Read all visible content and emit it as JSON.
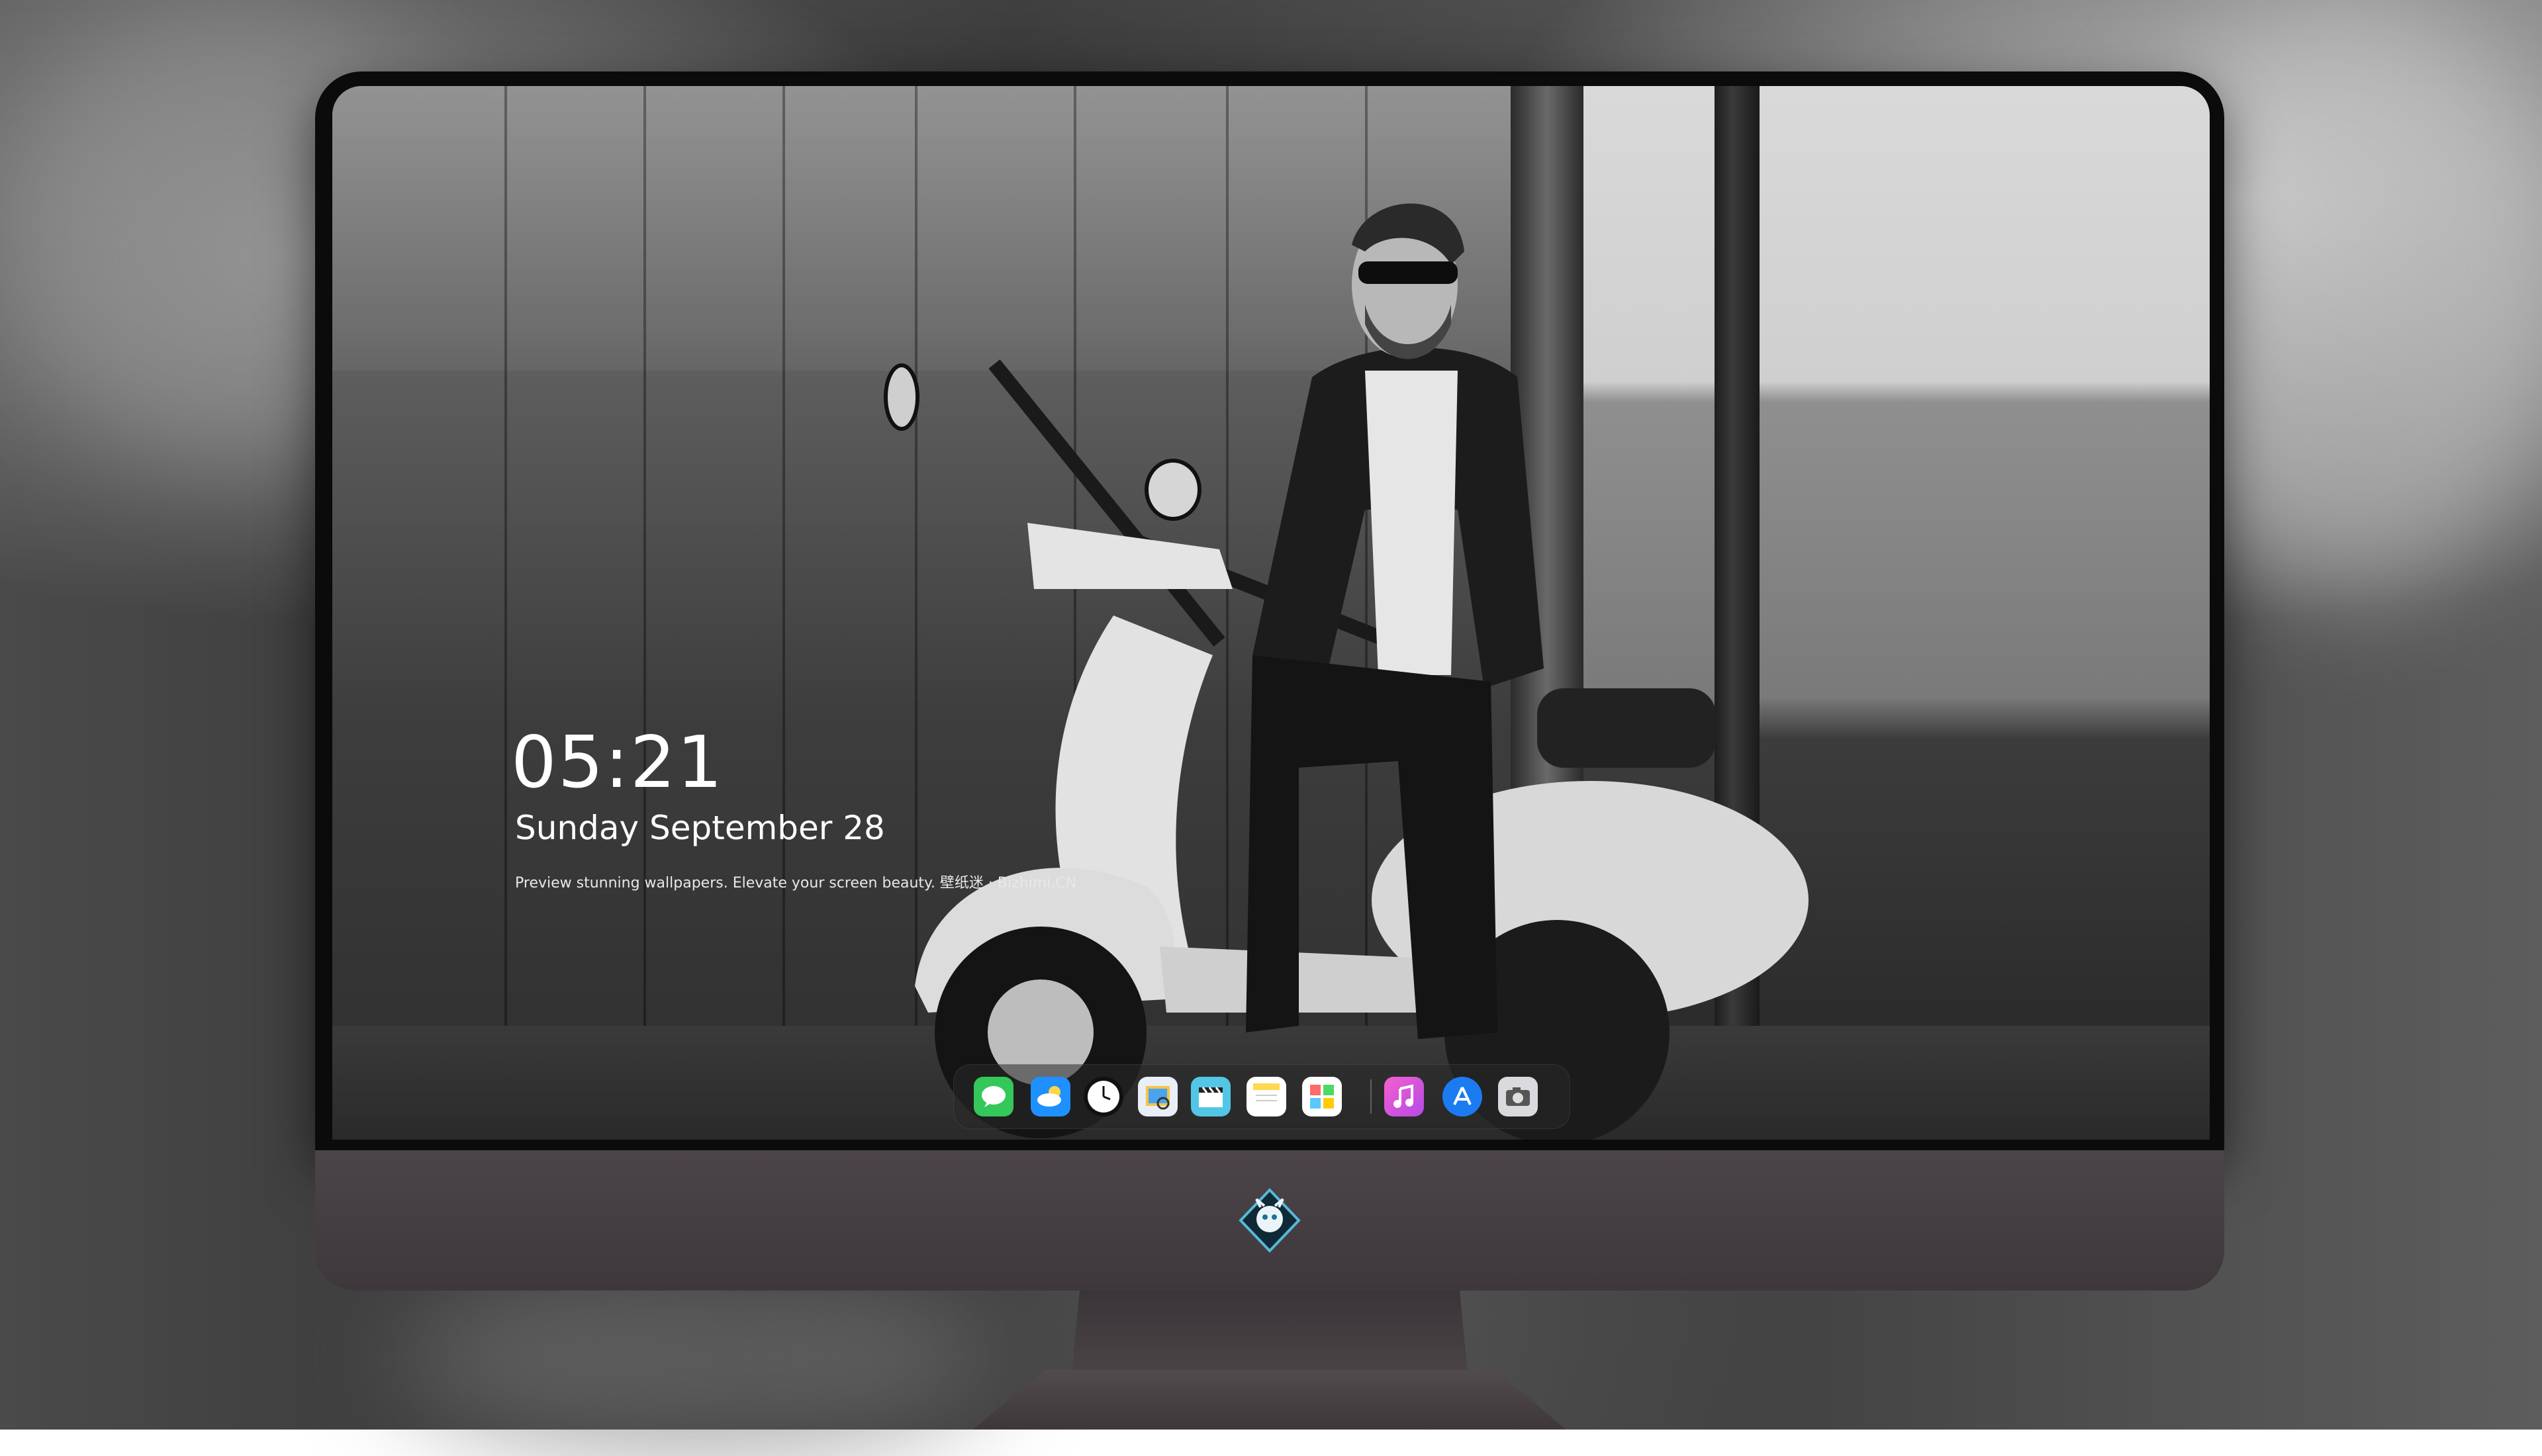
{
  "lock_screen": {
    "time": "05:21",
    "date": "Sunday September  28",
    "tagline": "Preview stunning wallpapers. Elevate your screen beauty. 壁纸迷 · Bizhimi.CN"
  },
  "dock": {
    "items": [
      {
        "name": "messages",
        "icon": "message-bubble-icon",
        "color": "#34c759"
      },
      {
        "name": "weather",
        "icon": "cloud-icon",
        "color": "#1e90ff"
      },
      {
        "name": "clock",
        "icon": "clock-icon",
        "color": "#ffffff"
      },
      {
        "name": "preview",
        "icon": "preview-icon",
        "color": "#f4c542"
      },
      {
        "name": "clips",
        "icon": "clapperboard-icon",
        "color": "#53c6e6"
      },
      {
        "name": "notes",
        "icon": "notes-icon",
        "color": "#ffd84d"
      },
      {
        "name": "photo-booth",
        "icon": "photo-grid-icon",
        "color": "#ff6b6b"
      },
      {
        "name": "music",
        "icon": "music-note-icon",
        "color": "#d64ad4"
      },
      {
        "name": "app-store",
        "icon": "app-store-icon",
        "color": "#1b7cf2"
      },
      {
        "name": "screenshot",
        "icon": "camera-icon",
        "color": "#8e8e93"
      }
    ]
  },
  "device": {
    "logo": "dragon-diamond-logo"
  }
}
